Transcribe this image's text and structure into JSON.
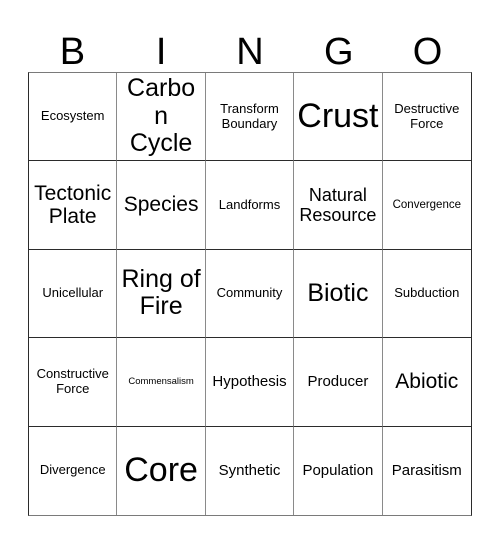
{
  "card": {
    "header_letters": [
      "B",
      "I",
      "N",
      "G",
      "O"
    ],
    "rows": [
      [
        {
          "label": "Ecosystem",
          "size": "fs-s"
        },
        {
          "label": "Carbon Cycle",
          "size": "fs-xxl"
        },
        {
          "label": "Transform Boundary",
          "size": "fs-s"
        },
        {
          "label": "Crust",
          "size": "fs-huge"
        },
        {
          "label": "Destructive Force",
          "size": "fs-s"
        }
      ],
      [
        {
          "label": "Tectonic Plate",
          "size": "fs-xl"
        },
        {
          "label": "Species",
          "size": "fs-xl"
        },
        {
          "label": "Landforms",
          "size": "fs-s"
        },
        {
          "label": "Natural Resource",
          "size": "fs-l"
        },
        {
          "label": "Convergence",
          "size": "fs-xs"
        }
      ],
      [
        {
          "label": "Unicellular",
          "size": "fs-s"
        },
        {
          "label": "Ring of Fire",
          "size": "fs-xxl"
        },
        {
          "label": "Community",
          "size": "fs-s"
        },
        {
          "label": "Biotic",
          "size": "fs-xxl"
        },
        {
          "label": "Subduction",
          "size": "fs-s"
        }
      ],
      [
        {
          "label": "Constructive Force",
          "size": "fs-s"
        },
        {
          "label": "Commensalism",
          "size": "fs-xxs"
        },
        {
          "label": "Hypothesis",
          "size": "fs-m"
        },
        {
          "label": "Producer",
          "size": "fs-m"
        },
        {
          "label": "Abiotic",
          "size": "fs-xl"
        }
      ],
      [
        {
          "label": "Divergence",
          "size": "fs-s"
        },
        {
          "label": "Core",
          "size": "fs-huge"
        },
        {
          "label": "Synthetic",
          "size": "fs-m"
        },
        {
          "label": "Population",
          "size": "fs-m"
        },
        {
          "label": "Parasitism",
          "size": "fs-m"
        }
      ]
    ],
    "colors": {
      "background": "#ffffff",
      "text": "#000000",
      "grid_line": "#2b2b2b"
    }
  }
}
